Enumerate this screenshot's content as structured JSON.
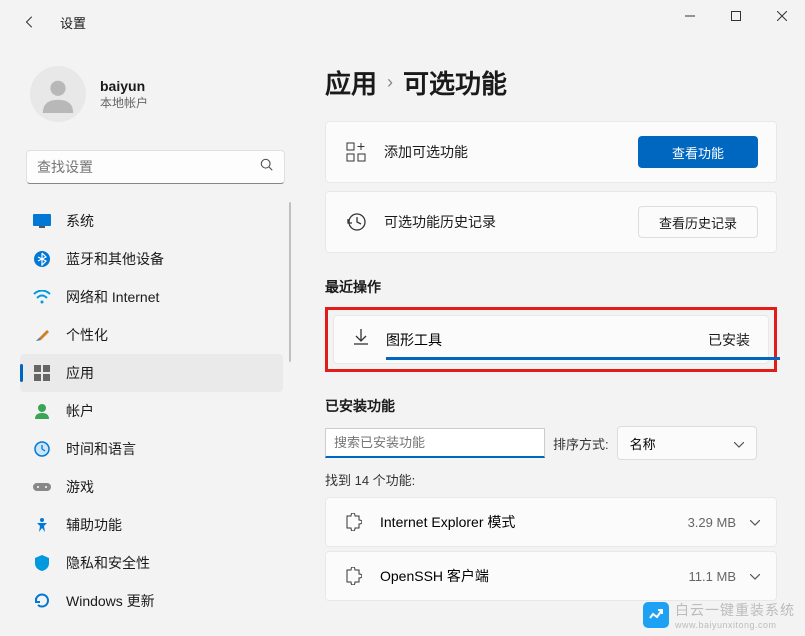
{
  "titlebar": {
    "title": "设置"
  },
  "user": {
    "name": "baiyun",
    "subtitle": "本地帐户"
  },
  "search": {
    "placeholder": "查找设置"
  },
  "nav": {
    "items": [
      {
        "label": "系统"
      },
      {
        "label": "蓝牙和其他设备"
      },
      {
        "label": "网络和 Internet"
      },
      {
        "label": "个性化"
      },
      {
        "label": "应用"
      },
      {
        "label": "帐户"
      },
      {
        "label": "时间和语言"
      },
      {
        "label": "游戏"
      },
      {
        "label": "辅助功能"
      },
      {
        "label": "隐私和安全性"
      },
      {
        "label": "Windows 更新"
      }
    ]
  },
  "breadcrumb": {
    "parent": "应用",
    "current": "可选功能"
  },
  "add_feature": {
    "label": "添加可选功能",
    "button": "查看功能"
  },
  "history": {
    "label": "可选功能历史记录",
    "button": "查看历史记录"
  },
  "recent": {
    "title": "最近操作",
    "item_name": "图形工具",
    "item_status": "已安装"
  },
  "installed": {
    "title": "已安装功能",
    "search_placeholder": "搜索已安装功能",
    "sort_label": "排序方式:",
    "sort_value": "名称",
    "found_text": "找到 14 个功能:",
    "features": [
      {
        "name": "Internet Explorer 模式",
        "size": "3.29 MB"
      },
      {
        "name": "OpenSSH 客户端",
        "size": "11.1 MB"
      }
    ]
  },
  "watermark": {
    "text": "白云一键重装系统",
    "url": "www.baiyunxitong.com"
  }
}
